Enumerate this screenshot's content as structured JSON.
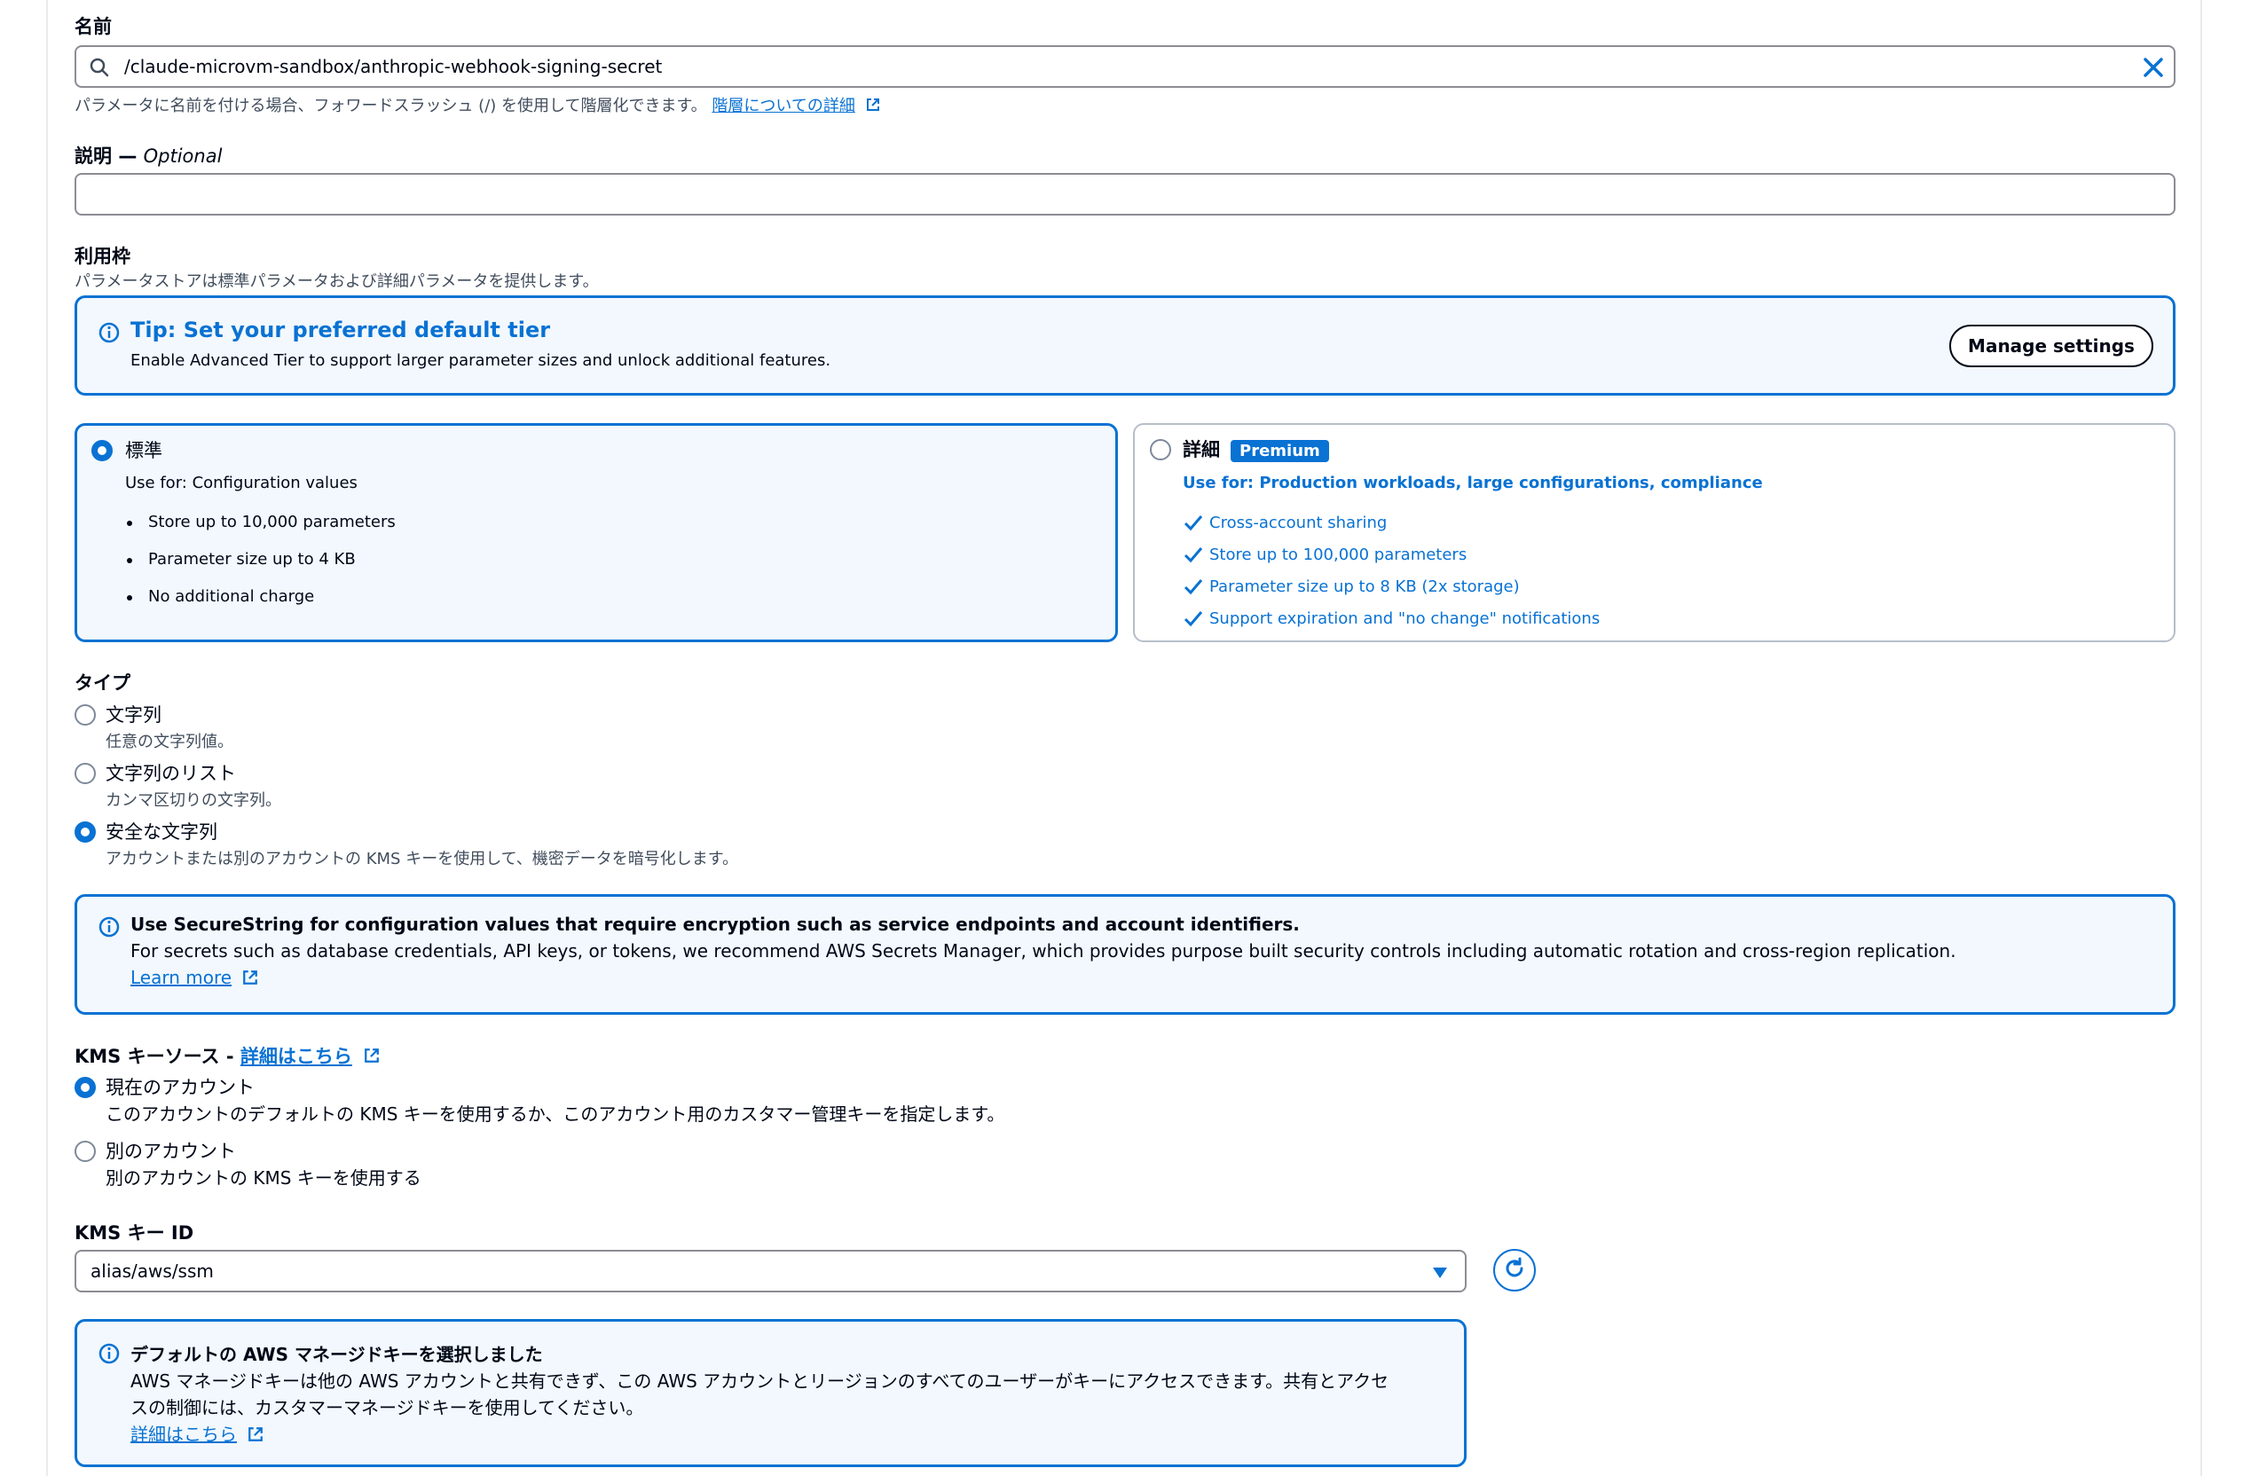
{
  "name_field": {
    "label": "名前",
    "value": "/claude-microvm-sandbox/anthropic-webhook-signing-secret",
    "hint": "パラメータに名前を付ける場合、フォワードスラッシュ (/) を使用して階層化できます。",
    "hint_link": "階層についての詳細"
  },
  "description_field": {
    "label": "説明",
    "optional": "Optional",
    "value": ""
  },
  "tier": {
    "label": "利用枠",
    "desc": "パラメータストアは標準パラメータおよび詳細パラメータを提供します。",
    "tip": {
      "title": "Tip: Set your preferred default tier",
      "body": "Enable Advanced Tier to support larger parameter sizes and unlock additional features.",
      "button": "Manage settings"
    },
    "standard": {
      "title": "標準",
      "use_for": "Use for: Configuration values",
      "items": [
        "Store up to 10,000 parameters",
        "Parameter size up to 4 KB",
        "No additional charge"
      ]
    },
    "advanced": {
      "title": "詳細",
      "badge": "Premium",
      "use_for": "Use for: Production workloads, large configurations, compliance",
      "items": [
        "Cross-account sharing",
        "Store up to 100,000 parameters",
        "Parameter size up to 8 KB (2x storage)",
        "Support expiration and \"no change\" notifications"
      ]
    }
  },
  "type": {
    "label": "タイプ",
    "options": [
      {
        "title": "文字列",
        "desc": "任意の文字列値。"
      },
      {
        "title": "文字列のリスト",
        "desc": "カンマ区切りの文字列。"
      },
      {
        "title": "安全な文字列",
        "desc": "アカウントまたは別のアカウントの KMS キーを使用して、機密データを暗号化します。"
      }
    ],
    "selected_index": 2
  },
  "secure_alert": {
    "title": "Use SecureString for configuration values that require encryption such as service endpoints and account identifiers.",
    "body": "For secrets such as database credentials, API keys, or tokens, we recommend AWS Secrets Manager, which provides purpose built security controls including automatic rotation and cross-region replication.",
    "link": "Learn more"
  },
  "kms_source": {
    "label": "KMS キーソース - ",
    "link": "詳細はこちら",
    "options": [
      {
        "title": "現在のアカウント",
        "desc": "このアカウントのデフォルトの KMS キーを使用するか、このアカウント用のカスタマー管理キーを指定します。"
      },
      {
        "title": "別のアカウント",
        "desc": "別のアカウントの KMS キーを使用する"
      }
    ],
    "selected_index": 0
  },
  "kms_key": {
    "label": "KMS キー ID",
    "value": "alias/aws/ssm"
  },
  "kms_alert": {
    "title": "デフォルトの AWS マネージドキーを選択しました",
    "body_line1": "AWS マネージドキーは他の AWS アカウントと共有できず、この AWS アカウントとリージョンのすべてのユーザーがキーにアクセスできます。共有とアクセ",
    "body_line2": "スの制御には、カスタマーマネージドキーを使用してください。",
    "link": "詳細はこちら"
  },
  "colors": {
    "accent": "#0972d3",
    "info_bg": "#f2f8fd",
    "text": "#000716",
    "muted": "#414d5c"
  }
}
